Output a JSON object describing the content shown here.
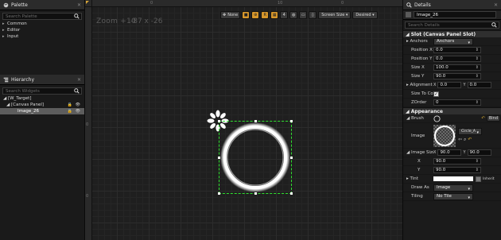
{
  "palette": {
    "tab_label": "Palette",
    "search_placeholder": "Search Palette",
    "categories": [
      {
        "arrow": "▸",
        "label": "Common"
      },
      {
        "arrow": "▸",
        "label": "Editor"
      },
      {
        "arrow": "▸",
        "label": "Input"
      }
    ]
  },
  "hierarchy": {
    "tab_label": "Hierarchy",
    "search_placeholder": "Search Widgets",
    "rows": [
      {
        "label": "◢ [W_Target]",
        "indent": 4,
        "selected": false,
        "eye": ""
      },
      {
        "label": "◢ [Canvas Panel]",
        "indent": 8,
        "selected": false,
        "eye": "🔒 👁"
      },
      {
        "label": "Image_26",
        "indent": 22,
        "selected": true,
        "eye": "🔒 👁"
      }
    ]
  },
  "viewport": {
    "zoom_label": "Zoom +10",
    "coords_label": "-87 x -26",
    "top_ruler_ticks": [
      "0",
      "10",
      "0"
    ],
    "left_ruler_ticks": [
      "0",
      "0"
    ],
    "toolbar": {
      "none_label": "None",
      "size_label": "4",
      "screen_size_label": "Screen Size ▾",
      "desired_label": "Desired ▾"
    }
  },
  "details": {
    "tab_label": "Details",
    "name_value": "Image_26",
    "search_placeholder": "Search Details",
    "slot_section": "◢ Slot (Canvas Panel Slot)",
    "anchors_label": "▸ Anchors",
    "anchors_value": "Anchors",
    "pos_x_label": "Position X",
    "pos_x_value": "0.0",
    "pos_y_label": "Position Y",
    "pos_y_value": "0.0",
    "size_x_label": "Size X",
    "size_x_value": "100.0",
    "size_y_label": "Size Y",
    "size_y_value": "90.0",
    "alignment_label": "▸ Alignment",
    "alignment_x": "0.0",
    "alignment_y": "0.0",
    "size_to_content_label": "Size To Conter",
    "zorder_label": "ZOrder",
    "zorder_value": "0",
    "appearance_section": "◢ Appearance",
    "brush_label": "◢ Brush",
    "bind_label": "Bind",
    "image_label": "Image",
    "image_asset": "Circle_A",
    "image_size_label": "◢ Image Size",
    "image_size_x": "90.0",
    "image_size_y": "90.0",
    "x_label": "X",
    "x_value": "90.0",
    "y_label": "Y",
    "y_value": "90.0",
    "tint_label": "▸ Tint",
    "inherit_label": "Inherit",
    "draw_as_label": "Draw As",
    "draw_as_value": "Image",
    "tiling_label": "Tiling",
    "tiling_value": "No Tile"
  },
  "colors": {
    "accent_orange": "#d6962b",
    "selection_green": "#2fe12f",
    "panel_bg": "#1b1b1b"
  }
}
